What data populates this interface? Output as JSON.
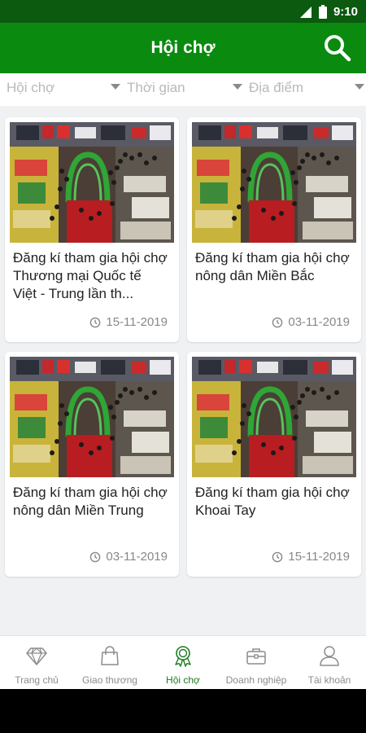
{
  "status": {
    "time": "9:10"
  },
  "header": {
    "title": "Hội chợ",
    "search_icon": "search-icon"
  },
  "filters": [
    {
      "label": "Hội chợ"
    },
    {
      "label": "Thời gian"
    },
    {
      "label": "Địa điểm"
    }
  ],
  "cards": [
    {
      "title": "Đăng kí tham gia hội chợ Thương mại Quốc tế Việt - Trung lần th...",
      "date": "15-11-2019"
    },
    {
      "title": "Đăng kí tham gia hội chợ nông dân Miền Bắc",
      "date": "03-11-2019"
    },
    {
      "title": "Đăng kí tham gia hội chợ nông dân Miền Trung",
      "date": "03-11-2019"
    },
    {
      "title": "Đăng kí tham gia hội chợ Khoai Tay",
      "date": "15-11-2019"
    }
  ],
  "nav": [
    {
      "label": "Trang chủ",
      "icon": "diamond-icon"
    },
    {
      "label": "Giao thương",
      "icon": "shopping-bag-icon"
    },
    {
      "label": "Hội chợ",
      "icon": "award-ribbon-icon",
      "active": true
    },
    {
      "label": "Doanh nghiệp",
      "icon": "briefcase-icon"
    },
    {
      "label": "Tài khoản",
      "icon": "user-icon"
    }
  ],
  "colors": {
    "primary": "#0a8a0f",
    "status_bar": "#0b5a0f",
    "active_nav": "#1e7b22",
    "background": "#f0f1f3"
  }
}
